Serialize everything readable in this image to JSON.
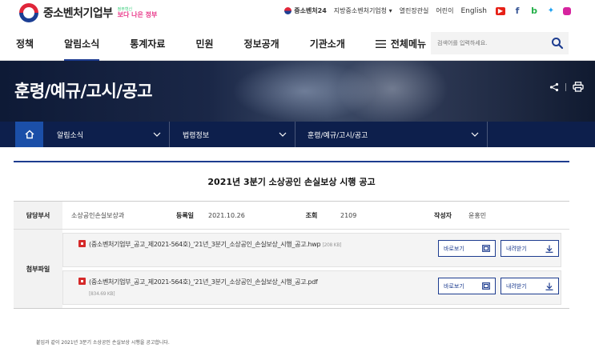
{
  "header": {
    "logo_text": "중소벤처기업부",
    "badge_small": "정부혁신",
    "badge_main": "보다 나은 정부",
    "util_links": [
      "중소벤처24",
      "지방중소벤처기업청 ▾",
      "열린장관실",
      "어린이",
      "English"
    ],
    "sns": [
      "youtube-icon",
      "facebook-icon",
      "blog-icon",
      "twitter-icon",
      "instagram-icon"
    ]
  },
  "gnb": {
    "items": [
      "정책",
      "알림소식",
      "통계자료",
      "민원",
      "정보공개",
      "기관소개"
    ],
    "active": "알림소식",
    "all_menu": "전체메뉴",
    "search_placeholder": "검색어를 입력하세요."
  },
  "hero": {
    "title": "훈령/예규/고시/공고"
  },
  "breadcrumb": [
    "알림소식",
    "법령정보",
    "훈령/예규/고시/공고"
  ],
  "post": {
    "title": "2021년 3분기 소상공인 손실보상 시행 공고",
    "dept_label": "담당부서",
    "dept": "소상공인손실보상과",
    "date_label": "등록일",
    "date": "2021.10.26",
    "views_label": "조회",
    "views": "2109",
    "author_label": "작성자",
    "author": "윤홍민",
    "attach_label": "첨부파일",
    "files": [
      {
        "name": "(중소벤처기업부_공고_제2021-564호)_'21년_3분기_소상공인_손실보상_시행_공고.hwp",
        "size": "[208 KB]"
      },
      {
        "name": "(중소벤처기업부_공고_제2021-564호)_'21년_3분기_소상공인_손실보상_시행_공고.pdf",
        "size": "[834.69 KB]"
      }
    ],
    "view_label": "바로보기",
    "download_label": "내려받기",
    "body": "붙임과 같이 2021년 3분기 소상공인 손실보상 시행을 공고합니다."
  },
  "colors": {
    "primary": "#1d3c8f",
    "location_bar": "#0d1f4c",
    "home_btn": "#1b4fa8"
  }
}
